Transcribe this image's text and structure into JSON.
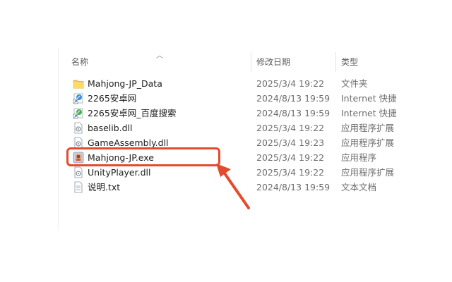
{
  "columns": {
    "name": "名称",
    "date": "修改日期",
    "type": "类型"
  },
  "files": [
    {
      "name": "Mahjong-JP_Data",
      "date": "2025/3/4 19:22",
      "type": "文件夹",
      "icon": "folder-icon"
    },
    {
      "name": "2265安卓网",
      "date": "2024/8/13 19:59",
      "type": "Internet 快捷方式",
      "icon": "internet-shortcut-icon"
    },
    {
      "name": "2265安卓网_百度搜索",
      "date": "2024/8/13 19:59",
      "type": "Internet 快捷方式",
      "icon": "internet-shortcut-icon"
    },
    {
      "name": "baselib.dll",
      "date": "2025/3/4 19:22",
      "type": "应用程序扩展",
      "icon": "dll-icon"
    },
    {
      "name": "GameAssembly.dll",
      "date": "2025/3/4 19:23",
      "type": "应用程序扩展",
      "icon": "dll-icon"
    },
    {
      "name": "Mahjong-JP.exe",
      "date": "2025/3/4 19:22",
      "type": "应用程序",
      "icon": "app-exe-icon"
    },
    {
      "name": "UnityPlayer.dll",
      "date": "2025/3/4 19:22",
      "type": "应用程序扩展",
      "icon": "dll-icon"
    },
    {
      "name": "说明.txt",
      "date": "2024/8/13 19:59",
      "type": "文本文档",
      "icon": "text-file-icon"
    }
  ],
  "colors": {
    "annotation": "#e34b2f",
    "folder": "#f7c948"
  }
}
